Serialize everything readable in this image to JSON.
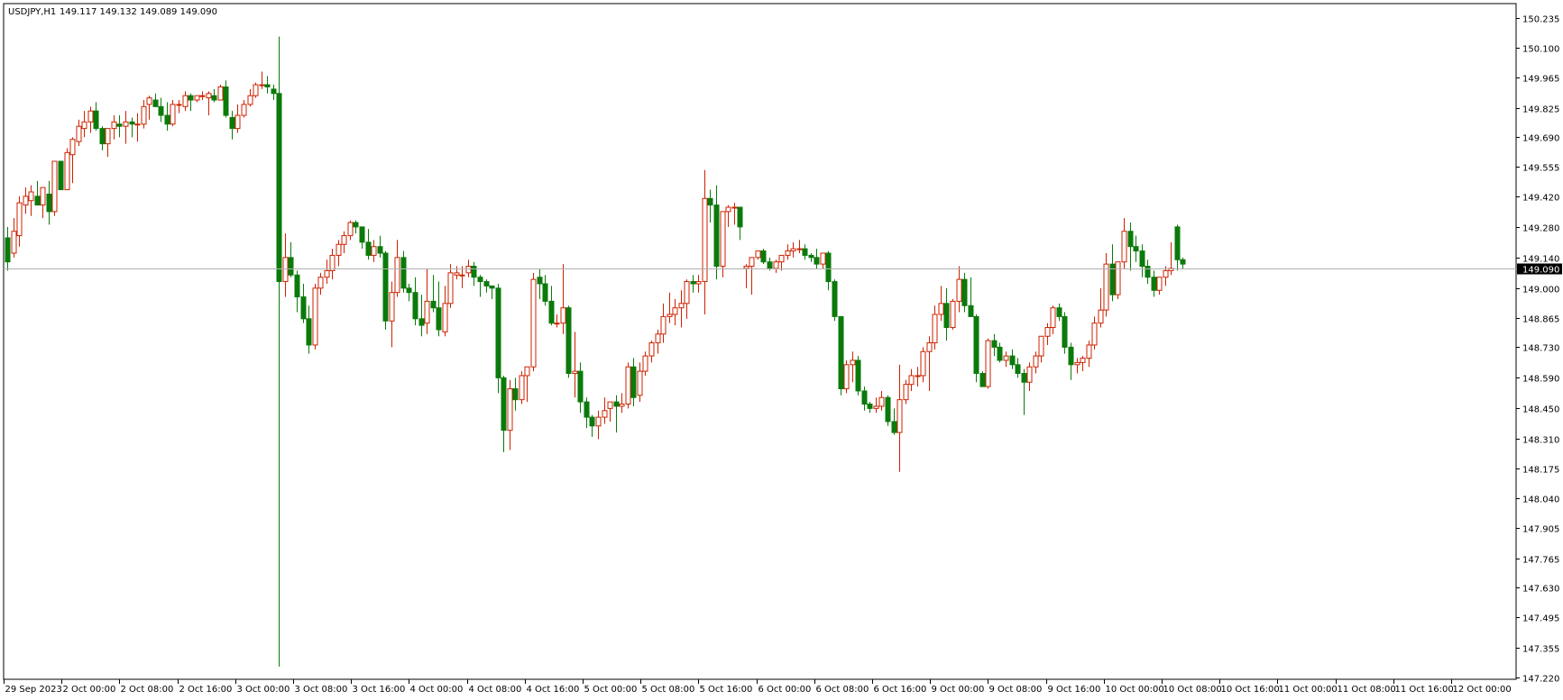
{
  "header": {
    "symbol": "USDJPY,H1",
    "ohlc": "149.117 149.132 149.089 149.090"
  },
  "colors": {
    "background": "#ffffff",
    "bull": "#cc2200",
    "bear": "#0a7a0a",
    "bid_line": "#b0b0b0",
    "axis": "#000000",
    "price_tag_bg": "#000000",
    "price_tag_fg": "#ffffff"
  },
  "price_axis": {
    "ticks": [
      "150.235",
      "150.100",
      "149.965",
      "149.825",
      "149.690",
      "149.555",
      "149.420",
      "149.280",
      "149.140",
      "149.000",
      "148.865",
      "148.730",
      "148.590",
      "148.450",
      "148.310",
      "148.175",
      "148.040",
      "147.905",
      "147.765",
      "147.630",
      "147.495",
      "147.355",
      "147.220"
    ],
    "current_price": "149.090"
  },
  "time_axis": {
    "labels": [
      "29 Sep 2023",
      "2 Oct 00:00",
      "2 Oct 08:00",
      "2 Oct 16:00",
      "3 Oct 00:00",
      "3 Oct 08:00",
      "3 Oct 16:00",
      "4 Oct 00:00",
      "4 Oct 08:00",
      "4 Oct 16:00",
      "5 Oct 00:00",
      "5 Oct 08:00",
      "5 Oct 16:00",
      "6 Oct 00:00",
      "6 Oct 08:00",
      "6 Oct 16:00",
      "9 Oct 00:00",
      "9 Oct 08:00",
      "9 Oct 16:00",
      "10 Oct 00:00",
      "10 Oct 08:00",
      "10 Oct 16:00",
      "11 Oct 00:00",
      "11 Oct 08:00",
      "11 Oct 16:00",
      "12 Oct 00:00"
    ]
  },
  "chart_data": {
    "type": "candlestick",
    "title": "USDJPY,H1",
    "ylim": [
      147.22,
      150.235
    ],
    "bars": [
      [
        149.23,
        149.28,
        149.08,
        149.12
      ],
      [
        149.16,
        149.32,
        149.14,
        149.26
      ],
      [
        149.24,
        149.42,
        149.19,
        149.39
      ],
      [
        149.38,
        149.46,
        149.34,
        149.42
      ],
      [
        149.4,
        149.47,
        149.33,
        149.44
      ],
      [
        149.42,
        149.49,
        149.38,
        149.38
      ],
      [
        149.38,
        149.45,
        149.32,
        149.46
      ],
      [
        149.43,
        149.49,
        149.29,
        149.35
      ],
      [
        149.35,
        149.58,
        149.33,
        149.58
      ],
      [
        149.58,
        149.58,
        149.45,
        149.45
      ],
      [
        149.45,
        149.64,
        149.45,
        149.62
      ],
      [
        149.61,
        149.69,
        149.48,
        149.68
      ],
      [
        149.67,
        149.77,
        149.65,
        149.74
      ],
      [
        149.73,
        149.81,
        149.69,
        149.76
      ],
      [
        149.76,
        149.83,
        149.71,
        149.81
      ],
      [
        149.81,
        149.85,
        149.72,
        149.73
      ],
      [
        149.73,
        149.74,
        149.63,
        149.66
      ],
      [
        149.66,
        149.72,
        149.6,
        149.73
      ],
      [
        149.73,
        149.79,
        149.68,
        149.76
      ],
      [
        149.75,
        149.79,
        149.69,
        149.74
      ],
      [
        149.74,
        149.81,
        149.66,
        149.76
      ],
      [
        149.76,
        149.78,
        149.69,
        149.75
      ],
      [
        149.75,
        149.8,
        149.67,
        149.75
      ],
      [
        149.75,
        149.86,
        149.73,
        149.83
      ],
      [
        149.84,
        149.88,
        149.77,
        149.87
      ],
      [
        149.86,
        149.89,
        149.83,
        149.83
      ],
      [
        149.83,
        149.87,
        149.76,
        149.79
      ],
      [
        149.79,
        149.85,
        149.72,
        149.75
      ],
      [
        149.75,
        149.86,
        149.74,
        149.84
      ],
      [
        149.84,
        149.86,
        149.8,
        149.84
      ],
      [
        149.83,
        149.9,
        149.81,
        149.88
      ],
      [
        149.88,
        149.89,
        149.81,
        149.86
      ],
      [
        149.86,
        149.88,
        149.85,
        149.88
      ],
      [
        149.88,
        149.9,
        149.86,
        149.88
      ],
      [
        149.87,
        149.9,
        149.79,
        149.89
      ],
      [
        149.88,
        149.91,
        149.85,
        149.86
      ],
      [
        149.86,
        149.93,
        149.86,
        149.92
      ],
      [
        149.92,
        149.95,
        149.78,
        149.79
      ],
      [
        149.78,
        149.81,
        149.68,
        149.73
      ],
      [
        149.73,
        149.84,
        149.71,
        149.79
      ],
      [
        149.79,
        149.86,
        149.78,
        149.84
      ],
      [
        149.84,
        149.91,
        149.83,
        149.88
      ],
      [
        149.88,
        149.94,
        149.87,
        149.93
      ],
      [
        149.93,
        149.99,
        149.91,
        149.93
      ],
      [
        149.93,
        149.97,
        149.89,
        149.92
      ],
      [
        149.91,
        149.93,
        149.86,
        149.89
      ],
      [
        149.89,
        150.15,
        147.27,
        149.03
      ],
      [
        149.03,
        149.25,
        148.96,
        149.14
      ],
      [
        149.14,
        149.21,
        149.05,
        149.06
      ],
      [
        149.06,
        149.08,
        148.89,
        148.96
      ],
      [
        148.96,
        149.02,
        148.84,
        148.86
      ],
      [
        148.86,
        148.92,
        148.7,
        148.74
      ],
      [
        148.74,
        149.02,
        148.72,
        149.0
      ],
      [
        149.0,
        149.07,
        148.97,
        149.05
      ],
      [
        149.05,
        149.13,
        149.02,
        149.08
      ],
      [
        149.08,
        149.18,
        149.04,
        149.15
      ],
      [
        149.15,
        149.22,
        149.1,
        149.2
      ],
      [
        149.2,
        149.26,
        149.16,
        149.24
      ],
      [
        149.24,
        149.31,
        149.22,
        149.3
      ],
      [
        149.3,
        149.31,
        149.25,
        149.28
      ],
      [
        149.28,
        149.28,
        149.18,
        149.21
      ],
      [
        149.21,
        149.27,
        149.13,
        149.15
      ],
      [
        149.15,
        149.22,
        149.12,
        149.19
      ],
      [
        149.19,
        149.24,
        149.14,
        149.16
      ],
      [
        149.16,
        149.17,
        148.81,
        148.85
      ],
      [
        148.85,
        149.03,
        148.73,
        148.98
      ],
      [
        148.98,
        149.22,
        148.96,
        149.14
      ],
      [
        149.14,
        149.17,
        148.98,
        149.0
      ],
      [
        149.0,
        149.02,
        148.94,
        148.98
      ],
      [
        148.98,
        149.05,
        148.83,
        148.86
      ],
      [
        148.86,
        148.97,
        148.78,
        148.83
      ],
      [
        148.84,
        149.09,
        148.79,
        148.94
      ],
      [
        148.94,
        149.06,
        148.89,
        148.91
      ],
      [
        148.91,
        149.03,
        148.78,
        148.81
      ],
      [
        148.8,
        149.01,
        148.78,
        148.93
      ],
      [
        148.93,
        149.11,
        148.91,
        149.07
      ],
      [
        149.06,
        149.1,
        149.04,
        149.07
      ],
      [
        149.06,
        149.1,
        149.0,
        149.06
      ],
      [
        149.07,
        149.13,
        149.05,
        149.1
      ],
      [
        149.1,
        149.12,
        149.01,
        149.05
      ],
      [
        149.05,
        149.06,
        148.96,
        149.03
      ],
      [
        149.03,
        149.04,
        148.98,
        149.01
      ],
      [
        149.01,
        149.01,
        148.95,
        149.0
      ],
      [
        149.0,
        149.02,
        148.52,
        148.59
      ],
      [
        148.59,
        148.6,
        148.25,
        148.35
      ],
      [
        148.35,
        148.58,
        148.26,
        148.54
      ],
      [
        148.54,
        148.59,
        148.44,
        148.49
      ],
      [
        148.49,
        148.62,
        148.47,
        148.6
      ],
      [
        148.6,
        148.64,
        148.48,
        148.64
      ],
      [
        148.64,
        149.07,
        148.62,
        149.04
      ],
      [
        149.05,
        149.09,
        148.95,
        149.02
      ],
      [
        149.02,
        149.06,
        148.92,
        148.94
      ],
      [
        148.94,
        149.01,
        148.83,
        148.84
      ],
      [
        148.84,
        148.88,
        148.82,
        148.84
      ],
      [
        148.84,
        149.11,
        148.79,
        148.91
      ],
      [
        148.91,
        148.92,
        148.59,
        148.61
      ],
      [
        148.61,
        148.8,
        148.5,
        148.62
      ],
      [
        148.62,
        148.66,
        148.43,
        148.48
      ],
      [
        148.48,
        148.5,
        148.36,
        148.41
      ],
      [
        148.41,
        148.42,
        148.32,
        148.37
      ],
      [
        148.37,
        148.44,
        148.31,
        148.41
      ],
      [
        148.41,
        148.5,
        148.38,
        148.44
      ],
      [
        148.45,
        148.48,
        148.39,
        148.48
      ],
      [
        148.48,
        148.51,
        148.34,
        148.46
      ],
      [
        148.46,
        148.52,
        148.43,
        148.47
      ],
      [
        148.47,
        148.66,
        148.45,
        148.64
      ],
      [
        148.64,
        148.68,
        148.46,
        148.5
      ],
      [
        148.51,
        148.66,
        148.48,
        148.62
      ],
      [
        148.62,
        148.71,
        148.6,
        148.69
      ],
      [
        148.69,
        148.76,
        148.66,
        148.75
      ],
      [
        148.75,
        148.81,
        148.7,
        148.79
      ],
      [
        148.79,
        148.93,
        148.75,
        148.87
      ],
      [
        148.87,
        148.98,
        148.84,
        148.88
      ],
      [
        148.88,
        148.95,
        148.83,
        148.91
      ],
      [
        148.91,
        148.99,
        148.82,
        148.93
      ],
      [
        148.93,
        149.04,
        148.86,
        149.03
      ],
      [
        149.03,
        149.06,
        148.98,
        149.02
      ],
      [
        149.02,
        149.06,
        148.98,
        149.03
      ],
      [
        149.03,
        149.54,
        148.88,
        149.41
      ],
      [
        149.41,
        149.45,
        149.3,
        149.38
      ],
      [
        149.38,
        149.47,
        149.04,
        149.1
      ],
      [
        149.1,
        149.35,
        149.05,
        149.35
      ],
      [
        149.35,
        149.38,
        149.28,
        149.37
      ],
      [
        149.37,
        149.39,
        149.29,
        149.37
      ],
      [
        149.37,
        149.37,
        149.22,
        149.28
      ],
      [
        149.09,
        149.11,
        149.0,
        149.1
      ],
      [
        149.1,
        149.14,
        148.97,
        149.14
      ],
      [
        149.14,
        149.17,
        149.13,
        149.17
      ],
      [
        149.17,
        149.18,
        149.11,
        149.12
      ],
      [
        149.12,
        149.14,
        149.08,
        149.09
      ],
      [
        149.09,
        149.13,
        149.07,
        149.12
      ],
      [
        149.12,
        149.15,
        149.08,
        149.15
      ],
      [
        149.15,
        149.2,
        149.13,
        149.17
      ],
      [
        149.17,
        149.21,
        149.14,
        149.18
      ],
      [
        149.18,
        149.22,
        149.16,
        149.18
      ],
      [
        149.18,
        149.2,
        149.13,
        149.15
      ],
      [
        149.15,
        149.16,
        149.12,
        149.14
      ],
      [
        149.14,
        149.18,
        149.09,
        149.11
      ],
      [
        149.11,
        149.16,
        149.09,
        149.16
      ],
      [
        149.16,
        149.17,
        148.99,
        149.03
      ],
      [
        149.03,
        149.04,
        148.85,
        148.87
      ],
      [
        148.87,
        148.87,
        148.51,
        148.54
      ],
      [
        148.54,
        148.67,
        148.52,
        148.65
      ],
      [
        148.65,
        148.71,
        148.57,
        148.67
      ],
      [
        148.67,
        148.69,
        148.51,
        148.53
      ],
      [
        148.53,
        148.55,
        148.44,
        148.47
      ],
      [
        148.47,
        148.48,
        148.43,
        148.45
      ],
      [
        148.45,
        148.5,
        148.43,
        148.46
      ],
      [
        148.46,
        148.53,
        148.44,
        148.5
      ],
      [
        148.5,
        148.51,
        148.37,
        148.39
      ],
      [
        148.39,
        148.45,
        148.33,
        148.34
      ],
      [
        148.34,
        148.65,
        148.16,
        148.49
      ],
      [
        148.49,
        148.58,
        148.47,
        148.56
      ],
      [
        148.56,
        148.63,
        148.53,
        148.6
      ],
      [
        148.6,
        148.64,
        148.55,
        148.6
      ],
      [
        148.6,
        148.73,
        148.57,
        148.71
      ],
      [
        148.71,
        148.78,
        148.53,
        148.75
      ],
      [
        148.75,
        148.92,
        148.72,
        148.88
      ],
      [
        148.88,
        149.01,
        148.85,
        148.93
      ],
      [
        148.93,
        149.0,
        148.76,
        148.82
      ],
      [
        148.82,
        148.95,
        148.81,
        148.94
      ],
      [
        148.94,
        149.1,
        148.89,
        149.04
      ],
      [
        149.04,
        149.07,
        148.89,
        148.92
      ],
      [
        148.92,
        149.05,
        148.87,
        148.87
      ],
      [
        148.87,
        148.88,
        148.57,
        148.61
      ],
      [
        148.61,
        148.62,
        148.55,
        148.55
      ],
      [
        148.55,
        148.77,
        148.54,
        148.76
      ],
      [
        148.76,
        148.79,
        148.69,
        148.73
      ],
      [
        148.73,
        148.75,
        148.66,
        148.67
      ],
      [
        148.67,
        148.71,
        148.64,
        148.69
      ],
      [
        148.69,
        148.72,
        148.63,
        148.65
      ],
      [
        148.65,
        148.68,
        148.59,
        148.61
      ],
      [
        148.61,
        148.63,
        148.42,
        148.57
      ],
      [
        148.57,
        148.66,
        148.53,
        148.64
      ],
      [
        148.64,
        148.71,
        148.61,
        148.69
      ],
      [
        148.69,
        148.78,
        148.66,
        148.78
      ],
      [
        148.78,
        148.84,
        148.74,
        148.82
      ],
      [
        148.82,
        148.92,
        148.79,
        148.91
      ],
      [
        148.91,
        148.93,
        148.85,
        148.87
      ],
      [
        148.87,
        148.89,
        148.7,
        148.73
      ],
      [
        148.73,
        148.75,
        148.58,
        148.65
      ],
      [
        148.65,
        148.68,
        148.61,
        148.66
      ],
      [
        148.66,
        148.69,
        148.62,
        148.68
      ],
      [
        148.68,
        148.76,
        148.64,
        148.74
      ],
      [
        148.74,
        148.87,
        148.72,
        148.84
      ],
      [
        148.84,
        149.0,
        148.82,
        148.9
      ],
      [
        148.9,
        149.16,
        148.87,
        149.11
      ],
      [
        149.11,
        149.2,
        148.94,
        148.97
      ],
      [
        148.97,
        149.12,
        148.95,
        149.12
      ],
      [
        149.12,
        149.32,
        149.09,
        149.26
      ],
      [
        149.26,
        149.3,
        149.08,
        149.19
      ],
      [
        149.19,
        149.24,
        149.12,
        149.17
      ],
      [
        149.17,
        149.2,
        149.05,
        149.1
      ],
      [
        149.1,
        149.13,
        149.02,
        149.05
      ],
      [
        149.05,
        149.08,
        148.96,
        148.99
      ],
      [
        148.99,
        149.05,
        148.97,
        149.05
      ],
      [
        149.05,
        149.1,
        149.01,
        149.08
      ],
      [
        149.08,
        149.21,
        149.06,
        149.09
      ],
      [
        149.28,
        149.29,
        149.08,
        149.13
      ],
      [
        149.13,
        149.14,
        149.09,
        149.11
      ]
    ]
  }
}
